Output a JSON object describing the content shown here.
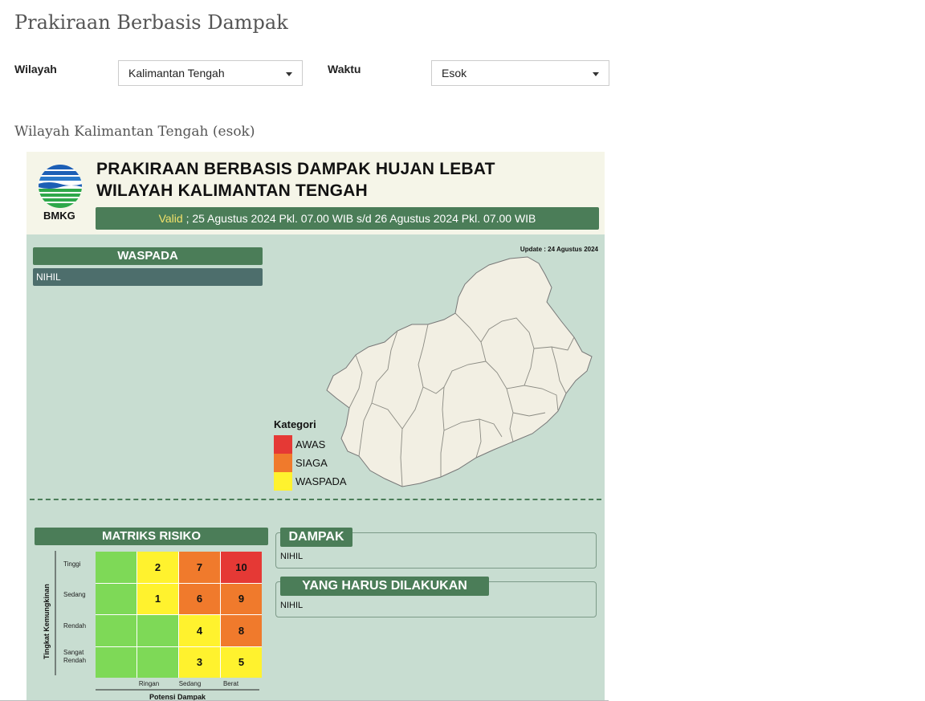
{
  "page": {
    "title": "Prakiraan Berbasis Dampak",
    "section_title": "Wilayah Kalimantan Tengah (esok)"
  },
  "filters": {
    "region_label": "Wilayah",
    "region_value": "Kalimantan Tengah",
    "time_label": "Waktu",
    "time_value": "Esok"
  },
  "poster": {
    "logo_text": "BMKG",
    "title_line1": "PRAKIRAAN BERBASIS DAMPAK HUJAN LEBAT",
    "title_line2": "WILAYAH KALIMANTAN TENGAH",
    "valid_word": "Valid",
    "valid_range": " ; 25 Agustus 2024 Pkl. 07.00 WIB s/d 26 Agustus 2024 Pkl. 07.00 WIB",
    "update": "Update : 24 Agustus 2024",
    "waspada_header": "WASPADA",
    "waspada_value": "NIHIL",
    "legend": {
      "title": "Kategori",
      "items": [
        {
          "label": "AWAS",
          "color": "#e53935"
        },
        {
          "label": "SIAGA",
          "color": "#f07a2c"
        },
        {
          "label": "WASPADA",
          "color": "#fff22e"
        }
      ]
    },
    "matrix": {
      "header": "MATRIKS RISIKO",
      "y_title": "Tingkat Kemungkinan",
      "x_title": "Potensi Dampak",
      "rows": [
        "Tinggi",
        "Sedang",
        "Rendah",
        "Sangat Rendah"
      ],
      "cols": [
        "Ringan",
        "Sedang",
        "Berat"
      ],
      "cells": [
        [
          {
            "v": "",
            "c": "#7ed957"
          },
          {
            "v": "2",
            "c": "#fff22e"
          },
          {
            "v": "7",
            "c": "#f07a2c"
          },
          {
            "v": "10",
            "c": "#e53935"
          }
        ],
        [
          {
            "v": "",
            "c": "#7ed957"
          },
          {
            "v": "1",
            "c": "#fff22e"
          },
          {
            "v": "6",
            "c": "#f07a2c"
          },
          {
            "v": "9",
            "c": "#f07a2c"
          }
        ],
        [
          {
            "v": "",
            "c": "#7ed957"
          },
          {
            "v": "",
            "c": "#7ed957"
          },
          {
            "v": "4",
            "c": "#fff22e"
          },
          {
            "v": "8",
            "c": "#f07a2c"
          }
        ],
        [
          {
            "v": "",
            "c": "#7ed957"
          },
          {
            "v": "",
            "c": "#7ed957"
          },
          {
            "v": "3",
            "c": "#fff22e"
          },
          {
            "v": "5",
            "c": "#fff22e"
          }
        ]
      ]
    },
    "dampak": {
      "header": "DAMPAK",
      "value": "NIHIL"
    },
    "todo": {
      "header": "YANG HARUS DILAKUKAN",
      "value": "NIHIL"
    }
  }
}
